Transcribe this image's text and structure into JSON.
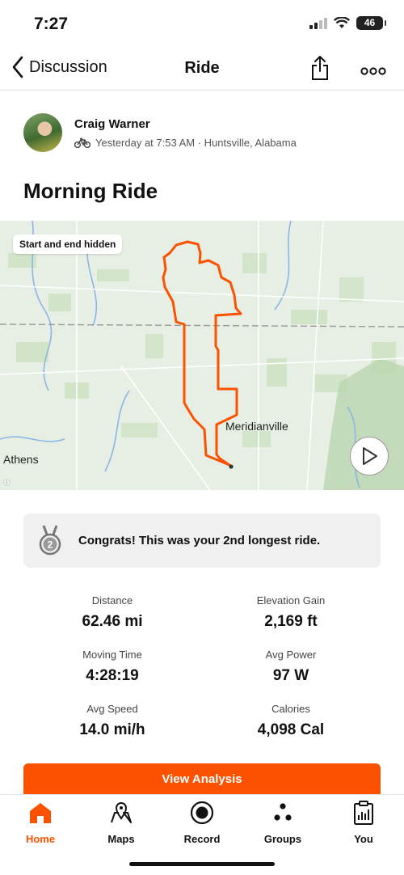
{
  "status_bar": {
    "time": "7:27",
    "battery": "46"
  },
  "nav": {
    "back_label": "Discussion",
    "title": "Ride"
  },
  "activity": {
    "athlete_name": "Craig Warner",
    "meta": "Yesterday at 7:53 AM · Huntsville, Alabama",
    "title": "Morning Ride"
  },
  "map": {
    "privacy_chip": "Start and end hidden",
    "labels": {
      "town_1": "Meridianville",
      "town_2": "Athens"
    },
    "route_color": "#fc5200"
  },
  "achievement": {
    "text": "Congrats! This was your 2nd longest ride.",
    "medal_rank": "2"
  },
  "stats": [
    {
      "label": "Distance",
      "value": "62.46 mi"
    },
    {
      "label": "Elevation Gain",
      "value": "2,169 ft"
    },
    {
      "label": "Moving Time",
      "value": "4:28:19"
    },
    {
      "label": "Avg Power",
      "value": "97 W"
    },
    {
      "label": "Avg Speed",
      "value": "14.0 mi/h"
    },
    {
      "label": "Calories",
      "value": "4,098 Cal"
    }
  ],
  "actions": {
    "view_analysis": "View Analysis"
  },
  "tabs": [
    {
      "label": "Home",
      "icon": "home-icon",
      "active": true
    },
    {
      "label": "Maps",
      "icon": "maps-icon",
      "active": false
    },
    {
      "label": "Record",
      "icon": "record-icon",
      "active": false
    },
    {
      "label": "Groups",
      "icon": "groups-icon",
      "active": false
    },
    {
      "label": "You",
      "icon": "you-icon",
      "active": false
    }
  ],
  "colors": {
    "accent": "#fc5200"
  }
}
